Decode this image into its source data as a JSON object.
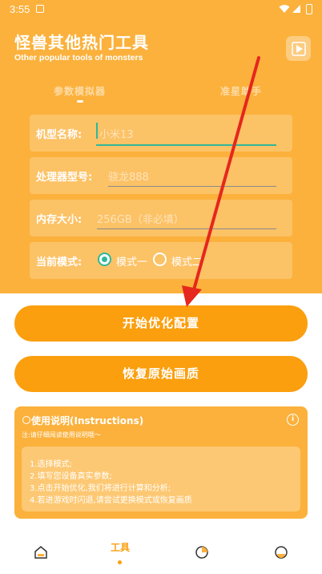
{
  "status_bar": {
    "time": "3:55"
  },
  "header": {
    "title": "怪兽其他热门工具",
    "subtitle": "Other popular tools of monsters"
  },
  "tabs": [
    {
      "label": "参数模拟器",
      "active": true
    },
    {
      "label": "准星助手",
      "active": false
    }
  ],
  "form": {
    "model": {
      "label": "机型名称:",
      "value": "小米13"
    },
    "processor": {
      "label": "处理器型号:",
      "placeholder": "骁龙888"
    },
    "memory": {
      "label": "内存大小:",
      "placeholder": "256GB（非必填）"
    },
    "mode": {
      "label": "当前模式:",
      "options": [
        {
          "label": "模式一",
          "selected": true
        },
        {
          "label": "模式二",
          "selected": false
        }
      ]
    }
  },
  "buttons": {
    "start": "开始优化配置",
    "restore": "恢复原始画质"
  },
  "instructions": {
    "title": "使用说明(Instructions)",
    "note": "注:请仔细阅读使用说明哦～",
    "items": [
      "1.选择模式;",
      "2.填写您设备真实参数;",
      "3.点击开始优化,我们将进行计算和分析;",
      "4.若进游戏时闪退,请尝试更换模式或恢复画质"
    ]
  },
  "bottom_nav": {
    "items": [
      {
        "icon": "home-icon",
        "label": ""
      },
      {
        "icon": "tool-icon",
        "label": "工具",
        "active": true
      },
      {
        "icon": "chart-icon",
        "label": ""
      },
      {
        "icon": "user-icon",
        "label": ""
      }
    ]
  },
  "colors": {
    "primary": "#FBB13C",
    "button": "#FB9F0E",
    "accent": "#2FB79A",
    "arrow": "#E5271D"
  }
}
